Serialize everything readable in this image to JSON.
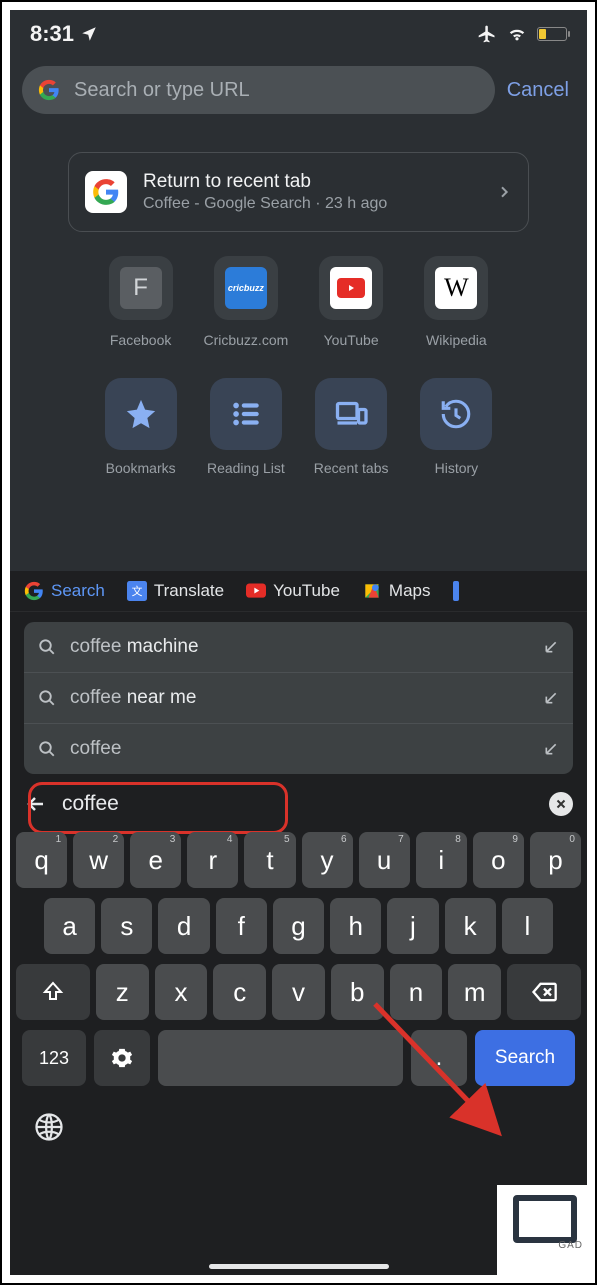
{
  "statusbar": {
    "time": "8:31"
  },
  "omnibar": {
    "placeholder": "Search or type URL",
    "cancel": "Cancel"
  },
  "recent": {
    "title": "Return to recent tab",
    "subtitle": "Coffee - Google Search · 23 h ago"
  },
  "shortcuts": [
    {
      "label": "Facebook"
    },
    {
      "label": "Cricbuzz.com"
    },
    {
      "label": "YouTube"
    },
    {
      "label": "Wikipedia"
    }
  ],
  "actions": [
    {
      "label": "Bookmarks"
    },
    {
      "label": "Reading List"
    },
    {
      "label": "Recent tabs"
    },
    {
      "label": "History"
    }
  ],
  "kb_apps": [
    {
      "label": "Search"
    },
    {
      "label": "Translate"
    },
    {
      "label": "YouTube"
    },
    {
      "label": "Maps"
    }
  ],
  "suggestions": [
    {
      "prefix": "coffee",
      "completion": " machine"
    },
    {
      "prefix": "coffee",
      "completion": " near me"
    },
    {
      "prefix": "coffee",
      "completion": ""
    }
  ],
  "query": "coffee",
  "keys": {
    "row1": [
      "q",
      "w",
      "e",
      "r",
      "t",
      "y",
      "u",
      "i",
      "o",
      "p"
    ],
    "row1_sup": [
      "1",
      "2",
      "3",
      "4",
      "5",
      "6",
      "7",
      "8",
      "9",
      "0"
    ],
    "row2": [
      "a",
      "s",
      "d",
      "f",
      "g",
      "h",
      "j",
      "k",
      "l"
    ],
    "row3": [
      "z",
      "x",
      "c",
      "v",
      "b",
      "n",
      "m"
    ],
    "num": "123",
    "dot": ".",
    "search": "Search"
  }
}
